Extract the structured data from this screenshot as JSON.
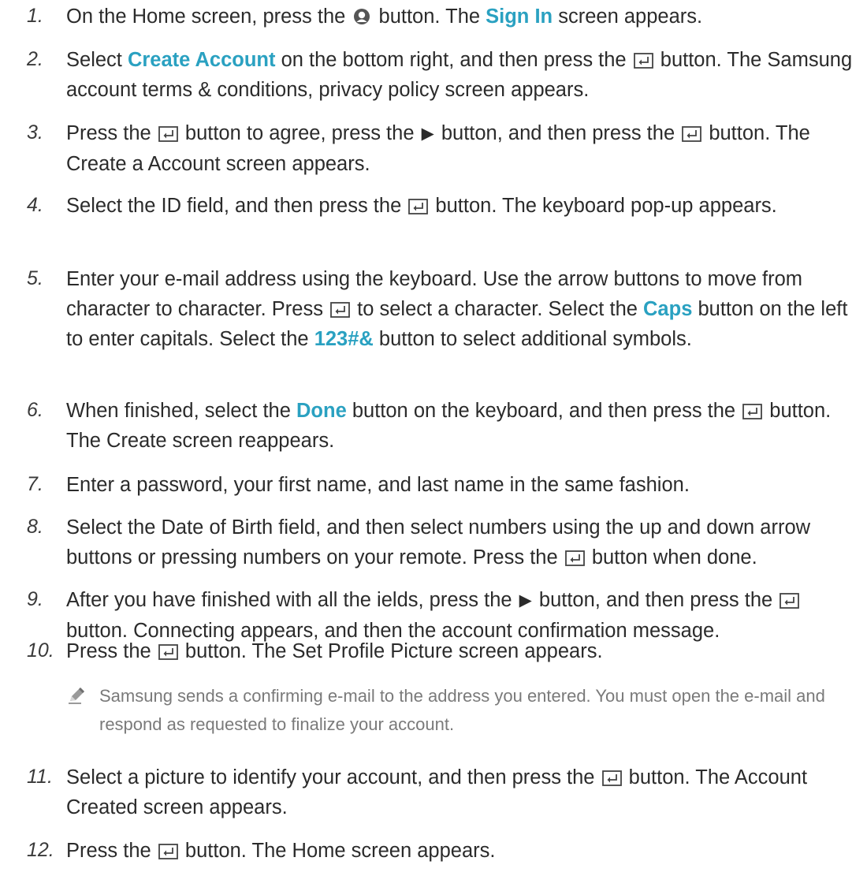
{
  "steps": [
    {
      "number": "1.",
      "segments": [
        {
          "text": "On the Home screen, press the "
        },
        {
          "icon": "person-icon"
        },
        {
          "text": " button. The "
        },
        {
          "text": "Sign In",
          "kw": true
        },
        {
          "text": " screen appears."
        }
      ]
    },
    {
      "number": "2.",
      "segments": [
        {
          "text": "Select "
        },
        {
          "text": "Create Account",
          "kw": true
        },
        {
          "text": " on the bottom right, and then press the "
        },
        {
          "icon": "enter-icon"
        },
        {
          "text": " button. The Samsung account terms & conditions, privacy policy screen appears."
        }
      ]
    },
    {
      "number": "3.",
      "segments": [
        {
          "text": "Press the "
        },
        {
          "icon": "enter-icon"
        },
        {
          "text": " button to agree, press the "
        },
        {
          "icon": "right-arrow-icon"
        },
        {
          "text": " button, and then press the "
        },
        {
          "icon": "enter-icon"
        },
        {
          "text": " button. The Create a Account screen appears."
        }
      ]
    },
    {
      "number": "4.",
      "segments": [
        {
          "text": "Select the ID field, and then press the "
        },
        {
          "icon": "enter-icon"
        },
        {
          "text": " button. The keyboard pop-up appears."
        }
      ]
    },
    {
      "number": "5.",
      "segments": [
        {
          "text": "Enter your e-mail address using the keyboard. Use the arrow buttons to move from character to character. Press "
        },
        {
          "icon": "enter-icon"
        },
        {
          "text": " to select a character. Select the "
        },
        {
          "text": "Caps",
          "kw": true
        },
        {
          "text": " button on the left to enter capitals. Select the "
        },
        {
          "text": "123#&",
          "kw": true
        },
        {
          "text": " button to select additional symbols."
        }
      ]
    },
    {
      "number": "6.",
      "segments": [
        {
          "text": "When finished, select the "
        },
        {
          "text": "Done",
          "kw": true
        },
        {
          "text": " button on the keyboard, and then press the "
        },
        {
          "icon": "enter-icon"
        },
        {
          "text": " button. The Create screen reappears."
        }
      ]
    },
    {
      "number": "7.",
      "segments": [
        {
          "text": "Enter a password, your first name, and last name in the same fashion."
        }
      ]
    },
    {
      "number": "8.",
      "segments": [
        {
          "text": "Select the Date of Birth field, and then select numbers using the up and down arrow buttons or pressing numbers on your remote. Press the "
        },
        {
          "icon": "enter-icon"
        },
        {
          "text": " button when done."
        }
      ]
    },
    {
      "number": "9.",
      "segments": [
        {
          "text": "After you have finished with all the ields, press the "
        },
        {
          "icon": "right-arrow-icon"
        },
        {
          "text": " button, and then press the "
        },
        {
          "icon": "enter-icon"
        },
        {
          "text": " button. Connecting appears, and then the account confirmation message."
        }
      ]
    },
    {
      "number": "10.",
      "segments": [
        {
          "text": "Press the "
        },
        {
          "icon": "enter-icon"
        },
        {
          "text": " button. The Set Profile Picture screen appears."
        }
      ]
    },
    {
      "number": "11.",
      "segments": [
        {
          "text": "Select a picture to identify your account, and then press the "
        },
        {
          "icon": "enter-icon"
        },
        {
          "text": " button. The Account Created screen appears."
        }
      ]
    },
    {
      "number": "12.",
      "segments": [
        {
          "text": "Press the "
        },
        {
          "icon": "enter-icon"
        },
        {
          "text": " button. The Home screen appears."
        }
      ]
    }
  ],
  "note": {
    "icon": "pencil-icon",
    "text": "Samsung sends a confirming e-mail to the address you entered. You must open the e-mail and respond as requested to finalize your account."
  },
  "colors": {
    "keyword": "#2aa1c1",
    "body_text": "#2b2b2b",
    "note_text": "#7a7a7a"
  }
}
